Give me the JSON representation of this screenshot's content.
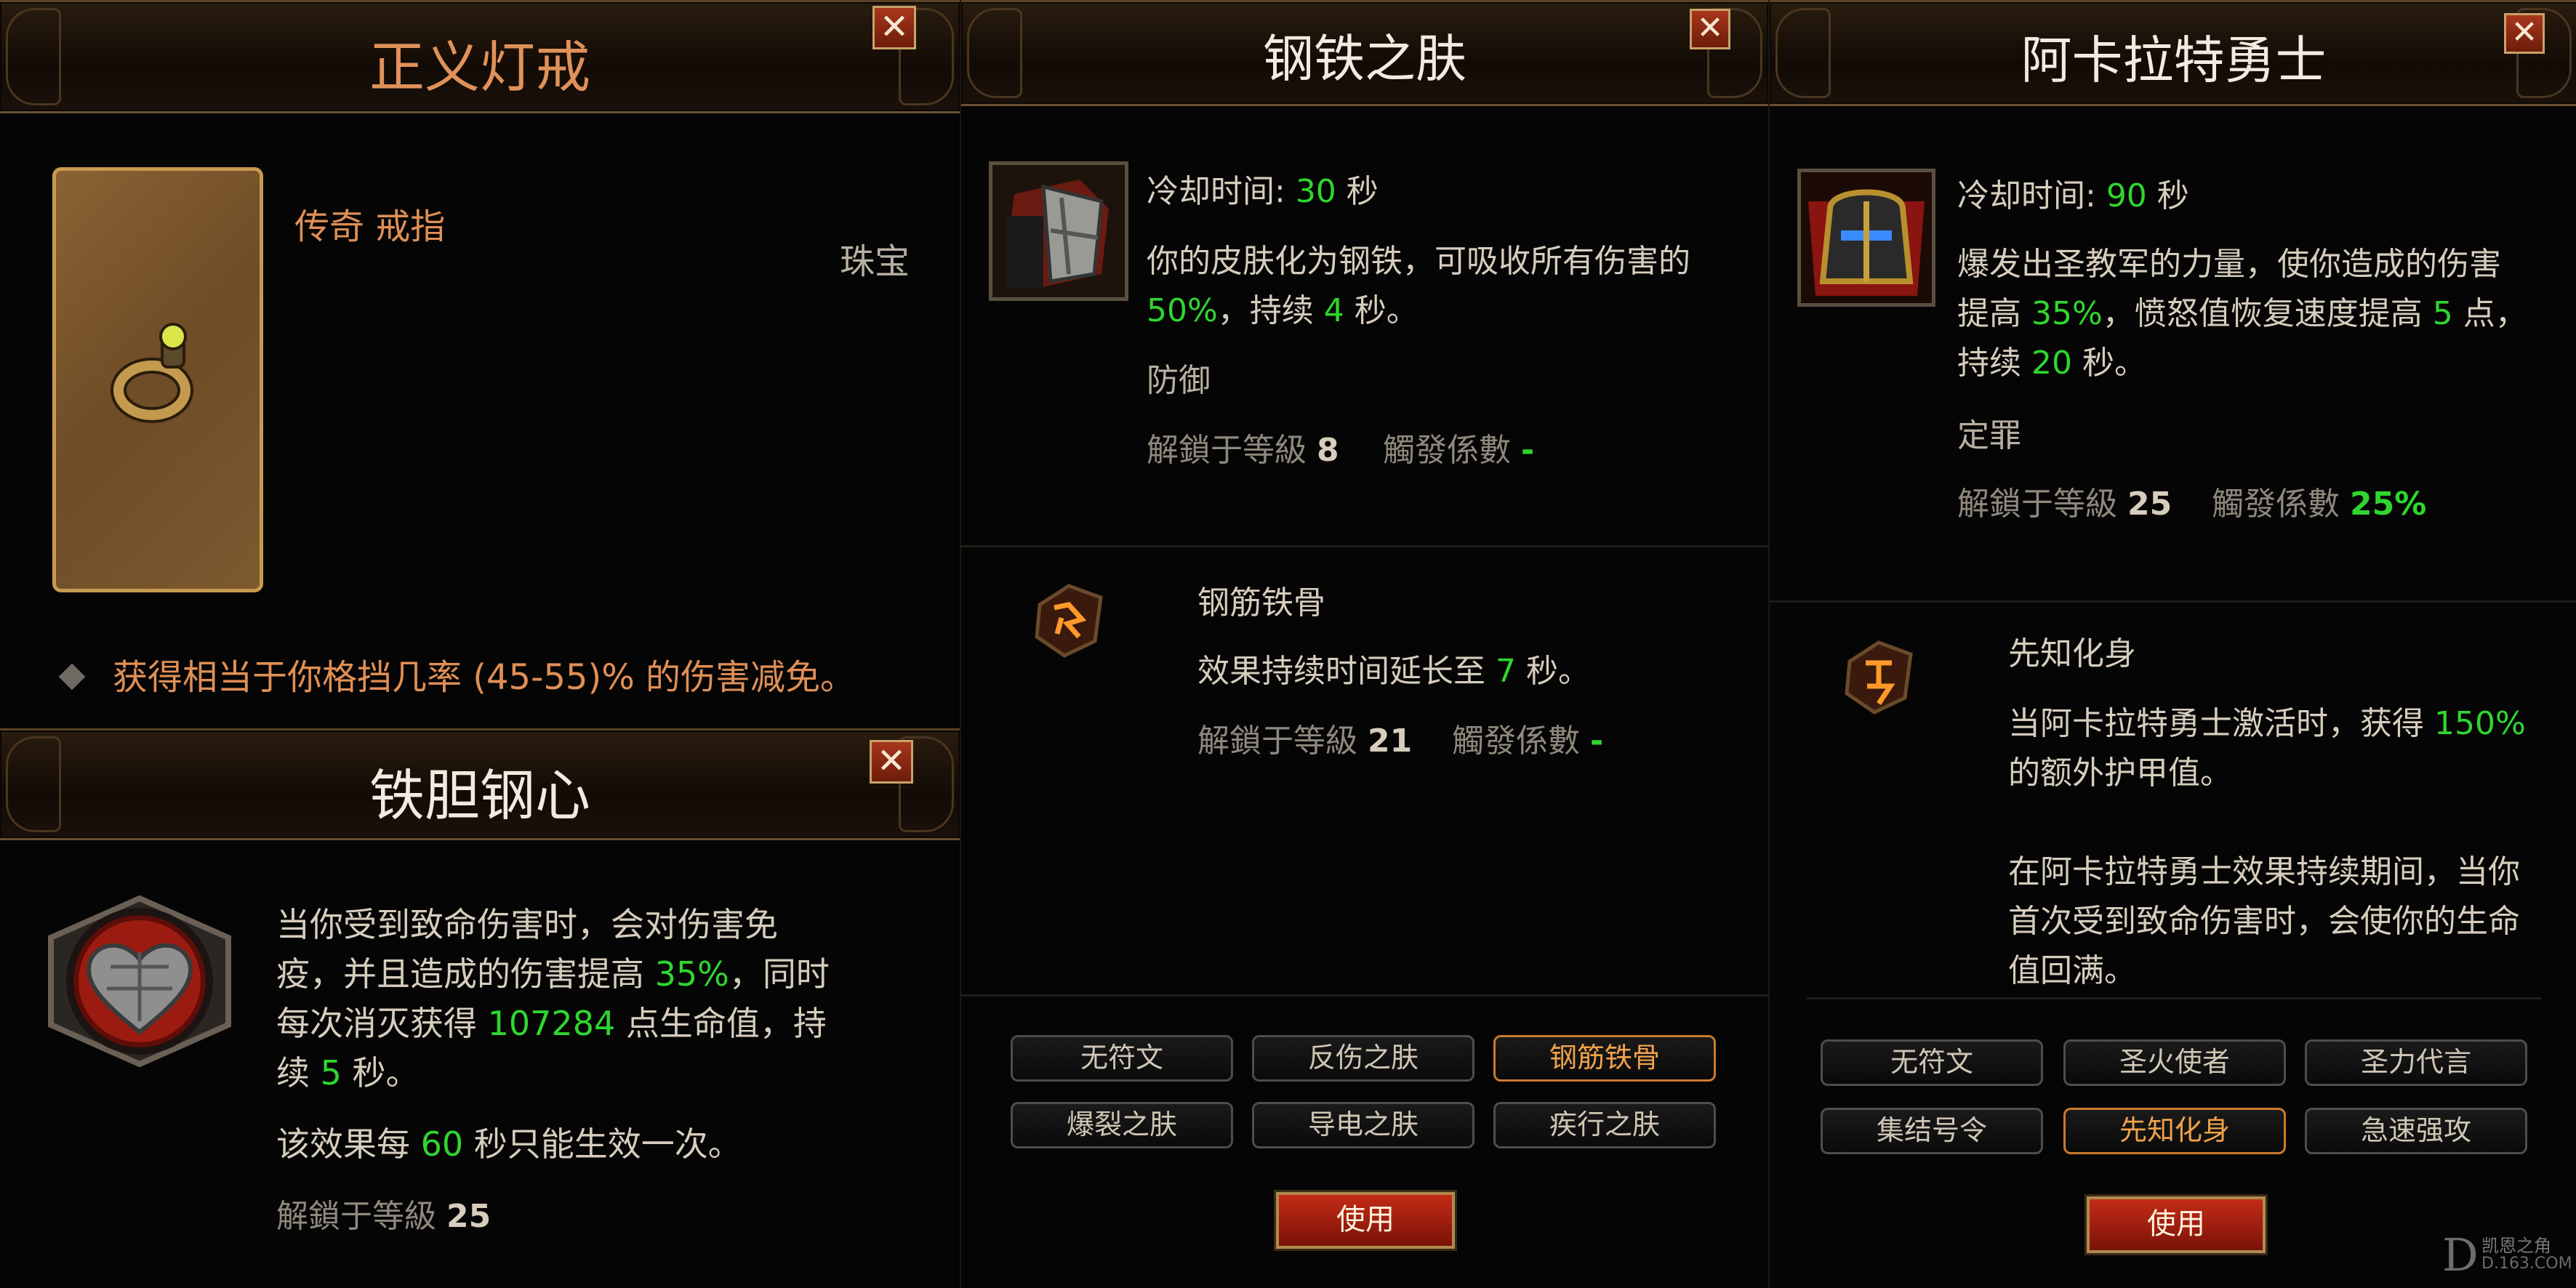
{
  "left_top": {
    "title": "正义灯戒",
    "item_type": "传奇 戒指",
    "category": "珠宝",
    "affix": "获得相当于你格挡几率 (45-55)% 的伤害减免。"
  },
  "left_bottom": {
    "title": "铁胆钢心",
    "desc_1": "当你受到致命伤害时，会对伤害免",
    "desc_2a": "疫，并且造成的伤害提高 ",
    "desc_2b": "35%",
    "desc_2c": "，同时",
    "desc_3a": "每次消灭获得 ",
    "desc_3b": "107284",
    "desc_3c": " 点生命值，持",
    "desc_4a": "续 ",
    "desc_4b": "5",
    "desc_4c": " 秒。",
    "cd_a": "该效果每 ",
    "cd_b": "60",
    "cd_c": " 秒只能生效一次。",
    "unlock_label": "解鎖于等級 ",
    "unlock_level": "25"
  },
  "mid": {
    "title": "钢铁之肤",
    "cooldown_label": "冷却时间: ",
    "cooldown_value": "30",
    "cooldown_unit": " 秒",
    "desc_1": "你的皮肤化为钢铁，可吸收所有伤害的",
    "desc_2a": "50%",
    "desc_2b": "，持续 ",
    "desc_2c": "4",
    "desc_2d": " 秒。",
    "category": "防御",
    "unlock_label": "解鎖于等級 ",
    "unlock_level": "8",
    "proc_label": "觸發係數 ",
    "proc_value": "-",
    "rune_name": "钢筋铁骨",
    "rune_desc_a": "效果持续时间延长至 ",
    "rune_desc_b": "7",
    "rune_desc_c": " 秒。",
    "rune_unlock_label": "解鎖于等級 ",
    "rune_unlock_level": "21",
    "rune_proc_label": "觸發係數 ",
    "rune_proc_value": "-",
    "runes": [
      "无符文",
      "反伤之肤",
      "钢筋铁骨",
      "爆裂之肤",
      "导电之肤",
      "疾行之肤"
    ],
    "use_label": "使用"
  },
  "right": {
    "title": "阿卡拉特勇士",
    "cooldown_label": "冷却时间: ",
    "cooldown_value": "90",
    "cooldown_unit": " 秒",
    "desc_1": "爆发出圣教军的力量，使你造成的伤害",
    "desc_2a": "提高 ",
    "desc_2b": "35%",
    "desc_2c": "，愤怒值恢复速度提高 ",
    "desc_2d": "5",
    "desc_2e": " 点，",
    "desc_3a": "持续 ",
    "desc_3b": "20",
    "desc_3c": " 秒。",
    "category": "定罪",
    "unlock_label": "解鎖于等級 ",
    "unlock_level": "25",
    "proc_label": "觸發係數 ",
    "proc_value": "25%",
    "rune_name": "先知化身",
    "rune_desc_1a": "当阿卡拉特勇士激活时，获得 ",
    "rune_desc_1b": "150%",
    "rune_desc_2": "的额外护甲值。",
    "rune_desc_3": "在阿卡拉特勇士效果持续期间，当你",
    "rune_desc_4": "首次受到致命伤害时，会使你的生命",
    "rune_desc_5": "值回满。",
    "runes": [
      "无符文",
      "圣火使者",
      "圣力代言",
      "集结号令",
      "先知化身",
      "急速强攻"
    ],
    "use_label": "使用"
  },
  "watermark": {
    "line1": "凯恩之角",
    "line2": "D.163.COM"
  },
  "colors": {
    "highlight_green": "#2fd62f",
    "legendary_orange": "#e08f55",
    "active_rune_border": "#c97a2e"
  }
}
